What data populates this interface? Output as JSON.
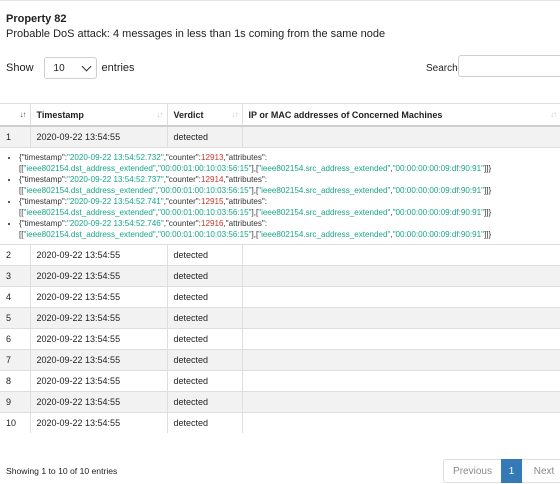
{
  "property": {
    "title": "Property 82",
    "description": "Probable DoS attack: 4 messages in less than 1s coming from the same node"
  },
  "length_control": {
    "show_label": "Show",
    "selected": "10",
    "entries_label": "entries"
  },
  "search": {
    "label": "Search:",
    "value": ""
  },
  "table": {
    "headers": {
      "index_sort": "↓↑",
      "timestamp": "Timestamp",
      "timestamp_sort": "↓↑",
      "verdict": "Verdict",
      "verdict_sort": "↓↑",
      "addresses": "IP or MAC addresses of  Concerned Machines",
      "addresses_sort": "↓↑"
    },
    "rows": [
      {
        "index": "1",
        "timestamp": "2020-09-22 13:54:55",
        "verdict": "detected"
      },
      {
        "index": "2",
        "timestamp": "2020-09-22 13:54:55",
        "verdict": "detected"
      },
      {
        "index": "3",
        "timestamp": "2020-09-22 13:54:55",
        "verdict": "detected"
      },
      {
        "index": "4",
        "timestamp": "2020-09-22 13:54:55",
        "verdict": "detected"
      },
      {
        "index": "5",
        "timestamp": "2020-09-22 13:54:55",
        "verdict": "detected"
      },
      {
        "index": "6",
        "timestamp": "2020-09-22 13:54:55",
        "verdict": "detected"
      },
      {
        "index": "7",
        "timestamp": "2020-09-22 13:54:55",
        "verdict": "detected"
      },
      {
        "index": "8",
        "timestamp": "2020-09-22 13:54:55",
        "verdict": "detected"
      },
      {
        "index": "9",
        "timestamp": "2020-09-22 13:54:55",
        "verdict": "detected"
      },
      {
        "index": "10",
        "timestamp": "2020-09-22 13:54:55",
        "verdict": "detected"
      }
    ],
    "details": [
      {
        "p0": "{\"timestamp\":",
        "ts": "\"2020-09-22 13:54:52.732\"",
        "p1": ",\"counter\":",
        "counter": "12913",
        "p2": ",\"attributes\":",
        "p3": "[[",
        "dst_key": "\"ieee802154.dst_address_extended\"",
        "dst_val": "\"00:00:01:00:10:03:56:15\"",
        "src_key": "\"ieee802154.src_address_extended\"",
        "src_val": "\"00:00:00:00:09:df:90:91\"",
        "end": "]]}"
      },
      {
        "p0": "{\"timestamp\":",
        "ts": "\"2020-09-22 13:54:52.737\"",
        "p1": ",\"counter\":",
        "counter": "12914",
        "p2": ",\"attributes\":",
        "p3": "[[",
        "dst_key": "\"ieee802154.dst_address_extended\"",
        "dst_val": "\"00:00:01:00:10:03:56:15\"",
        "src_key": "\"ieee802154.src_address_extended\"",
        "src_val": "\"00:00:00:00:09:df:90:91\"",
        "end": "]]}"
      },
      {
        "p0": "{\"timestamp\":",
        "ts": "\"2020-09-22 13:54:52.741\"",
        "p1": ",\"counter\":",
        "counter": "12915",
        "p2": ",\"attributes\":",
        "p3": "[[",
        "dst_key": "\"ieee802154.dst_address_extended\"",
        "dst_val": "\"00:00:01:00:10:03:56:15\"",
        "src_key": "\"ieee802154.src_address_extended\"",
        "src_val": "\"00:00:00:00:09:df:90:91\"",
        "end": "]]}"
      },
      {
        "p0": "{\"timestamp\":",
        "ts": "\"2020-09-22 13:54:52.746\"",
        "p1": ",\"counter\":",
        "counter": "12916",
        "p2": ",\"attributes\":",
        "p3": "[[",
        "dst_key": "\"ieee802154.dst_address_extended\"",
        "dst_val": "\"00:00:01:00:10:03:56:15\"",
        "src_key": "\"ieee802154.src_address_extended\"",
        "src_val": "\"00:00:00:00:09:df:90:91\"",
        "end": "]]}"
      }
    ],
    "separators": {
      "mid": ",",
      "bridge": "],["
    }
  },
  "footer": {
    "info": "Showing 1 to 10 of 10 entries",
    "previous": "Previous",
    "current_page": "1",
    "next": "Next"
  },
  "colors": {
    "string": "#17a589",
    "number": "#c0392b",
    "active_page": "#337ab7",
    "stripe": "#f2f2f2"
  }
}
